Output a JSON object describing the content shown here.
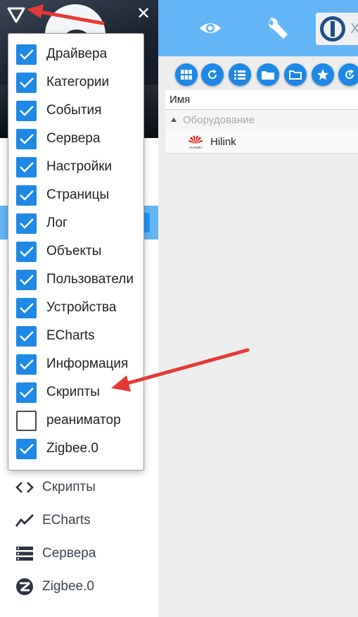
{
  "sidebar": {
    "items": [
      {
        "label": "Скрипты",
        "icon": "code-icon"
      },
      {
        "label": "ECharts",
        "icon": "chart-line-icon"
      },
      {
        "label": "Сервера",
        "icon": "server-icon"
      },
      {
        "label": "Zigbee.0",
        "icon": "zigbee-icon"
      }
    ]
  },
  "topbar": {
    "icons": [
      "eye-icon",
      "wrench-icon",
      "iobroker-logo"
    ],
    "logo_text": "X"
  },
  "toolbar": {
    "buttons": [
      "grid-view-icon",
      "refresh-icon",
      "list-view-icon",
      "folder-icon",
      "folder-open-icon",
      "star-icon",
      "history-icon"
    ]
  },
  "table": {
    "column_header": "Имя",
    "group": "Оборудование",
    "device": {
      "name": "Hilink",
      "brand": "HUAWEI",
      "icon": "huawei-logo"
    }
  },
  "dropdown": {
    "items": [
      {
        "label": "Драйвера",
        "checked": true
      },
      {
        "label": "Категории",
        "checked": true
      },
      {
        "label": "События",
        "checked": true
      },
      {
        "label": "Сервера",
        "checked": true
      },
      {
        "label": "Настройки",
        "checked": true
      },
      {
        "label": "Страницы",
        "checked": true
      },
      {
        "label": "Лог",
        "checked": true
      },
      {
        "label": "Объекты",
        "checked": true
      },
      {
        "label": "Пользователи",
        "checked": true
      },
      {
        "label": "Устройства",
        "checked": true
      },
      {
        "label": "ECharts",
        "checked": true
      },
      {
        "label": "Информация",
        "checked": true
      },
      {
        "label": "Скрипты",
        "checked": true
      },
      {
        "label": "реаниматор",
        "checked": false
      },
      {
        "label": "Zigbee.0",
        "checked": true
      }
    ]
  },
  "colors": {
    "accent": "#64b5f6",
    "button": "#1e88e5",
    "annotation_arrow": "#e53935"
  }
}
